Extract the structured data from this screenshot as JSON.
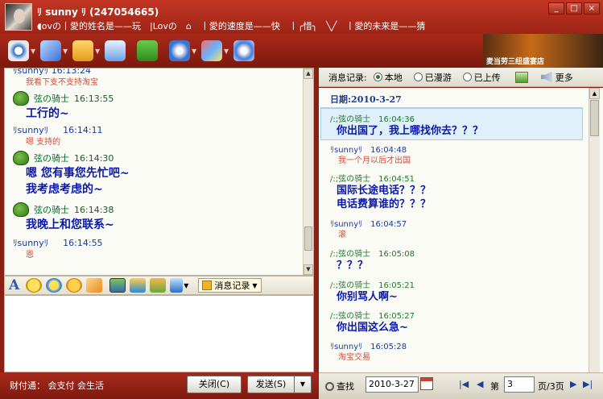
{
  "window": {
    "title_name": "ﾘ sunny ﾘ (247054665)",
    "signature": "◖ovの丨愛的姓名是——玩　|Lovの　⌂　丨愛的速度是——快　丨╭惜╮　╲╱　丨愛的未来是——猜",
    "buttons": [
      "_",
      "□",
      "×"
    ]
  },
  "toolbar": {
    "icons": [
      "video-icon",
      "microphone-icon",
      "folder-icon",
      "mail-icon",
      "add-app-icon",
      "network-icon",
      "game-icon",
      "settings-icon"
    ],
    "ad_text": "麦当劳三纽盛宴店"
  },
  "chat": {
    "top_partial_name": "ﾘsunnyﾘ 16:13:24",
    "top_partial_text": "我看下支不支持淘宝",
    "messages": [
      {
        "sender": "弦の骑士",
        "time": "16:13:55",
        "big": [
          "工行的~"
        ],
        "me": false
      },
      {
        "sender": "ﾘsunnyﾘ",
        "time": "16:14:11",
        "small": "嗯 支持的",
        "me": true
      },
      {
        "sender": "弦の骑士",
        "time": "16:14:30",
        "big": [
          "嗯 您有事您先忙吧~",
          "我考虑考虑的~"
        ],
        "me": false
      },
      {
        "sender": "弦の骑士",
        "time": "16:14:38",
        "big": [
          "我晚上和您联系~"
        ],
        "me": false
      },
      {
        "sender": "ﾘsunnyﾘ",
        "time": "16:14:55",
        "small": "恩",
        "me": true
      }
    ]
  },
  "format_bar": {
    "font_label": "A",
    "record_label": "消息记录"
  },
  "bottom": {
    "caifu": "财付通： 会支付 会生活",
    "close_label": "关闭(C)",
    "send_label": "发送(S)"
  },
  "history": {
    "title": "消息记录:",
    "radios": [
      {
        "label": "本地",
        "selected": true
      },
      {
        "label": "已漫游",
        "selected": false
      },
      {
        "label": "已上传",
        "selected": false
      }
    ],
    "more_label": "更多",
    "date_label": "日期:2010-3-27",
    "messages": [
      {
        "hd": "/:;弦の骑士　16:04:36",
        "big": [
          "你出国了，我上哪找你去？？？"
        ],
        "me": false
      },
      {
        "hd": "ﾘsunnyﾘ　16:04:48",
        "small": "我一个月以后才出国",
        "me": true
      },
      {
        "hd": "/:;弦の骑士　16:04:51",
        "big": [
          "国际长途电话？？？",
          "电话费算谁的？？？"
        ],
        "me": false
      },
      {
        "hd": "ﾘsunnyﾘ　16:04:57",
        "small": "滚",
        "me": true
      },
      {
        "hd": "/:;弦の骑士　16:05:08",
        "big": [
          "？？？"
        ],
        "me": false
      },
      {
        "hd": "/:;弦の骑士　16:05:21",
        "big": [
          "你别骂人啊~"
        ],
        "me": false
      },
      {
        "hd": "/:;弦の骑士　16:05:27",
        "big": [
          "你出国这么急~"
        ],
        "me": false
      },
      {
        "hd": "ﾘsunnyﾘ　16:05:28",
        "small": "淘宝交易",
        "me": true
      }
    ],
    "footer": {
      "find_label": "查找",
      "date_value": "2010-3-27",
      "page_prefix": "第",
      "page_value": "3",
      "page_suffix": "页/3页"
    }
  }
}
